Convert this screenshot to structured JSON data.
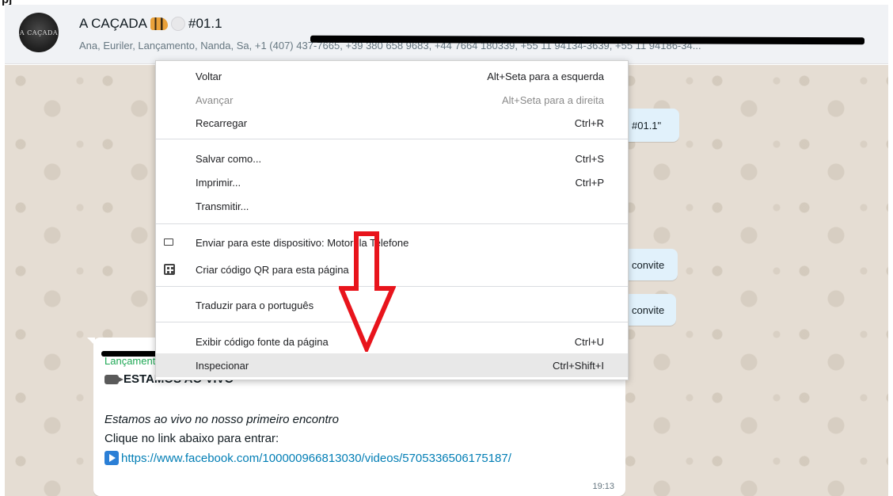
{
  "chat": {
    "title": "A CAÇADA",
    "title_suffix": "#01.1",
    "avatar_text": "A CAÇADA",
    "members": "Ana, Euriler, Lançamento, Nanda, Sa, +1 (407) 437-7665, +39 380 658 9683, +44 7664 180339, +55 11 94134-3639, +55 11 94186-34..."
  },
  "bubbles": {
    "quote": "#01.1\"",
    "invite_1": "convite",
    "invite_2": "convite"
  },
  "message": {
    "sender": "Lançamento",
    "headline": "ESTAMOS AO VIVO",
    "italic": "Estamos ao vivo no nosso primeiro encontro",
    "line": "Clique no link abaixo para entrar:",
    "link": "https://www.facebook.com/100000966813030/videos/5705336506175187/",
    "time": "19:13"
  },
  "context_menu": {
    "back": {
      "label": "Voltar",
      "shortcut": "Alt+Seta para a esquerda"
    },
    "forward": {
      "label": "Avançar",
      "shortcut": "Alt+Seta para a direita"
    },
    "reload": {
      "label": "Recarregar",
      "shortcut": "Ctrl+R"
    },
    "save_as": {
      "label": "Salvar como...",
      "shortcut": "Ctrl+S"
    },
    "print": {
      "label": "Imprimir...",
      "shortcut": "Ctrl+P"
    },
    "cast": {
      "label": "Transmitir..."
    },
    "send_to_device": {
      "label": "Enviar para este dispositivo: Motorola Telefone"
    },
    "qr_code": {
      "label": "Criar código QR para esta página"
    },
    "translate": {
      "label": "Traduzir para o português"
    },
    "view_source": {
      "label": "Exibir código fonte da página",
      "shortcut": "Ctrl+U"
    },
    "inspect": {
      "label": "Inspecionar",
      "shortcut": "Ctrl+Shift+I"
    }
  },
  "corner_text": "pj",
  "colors": {
    "header_bg": "#f0f2f5",
    "chat_bg": "#e5ddd3",
    "link": "#027eb5",
    "sender": "#1fa855",
    "annotation_arrow": "#e8141c",
    "menu_highlight": "#e8e8e8"
  },
  "icons": [
    "tiger-icon",
    "moon-icon",
    "camera-icon",
    "arrow-right-icon",
    "cast-icon",
    "qr-icon",
    "red-down-arrow"
  ]
}
